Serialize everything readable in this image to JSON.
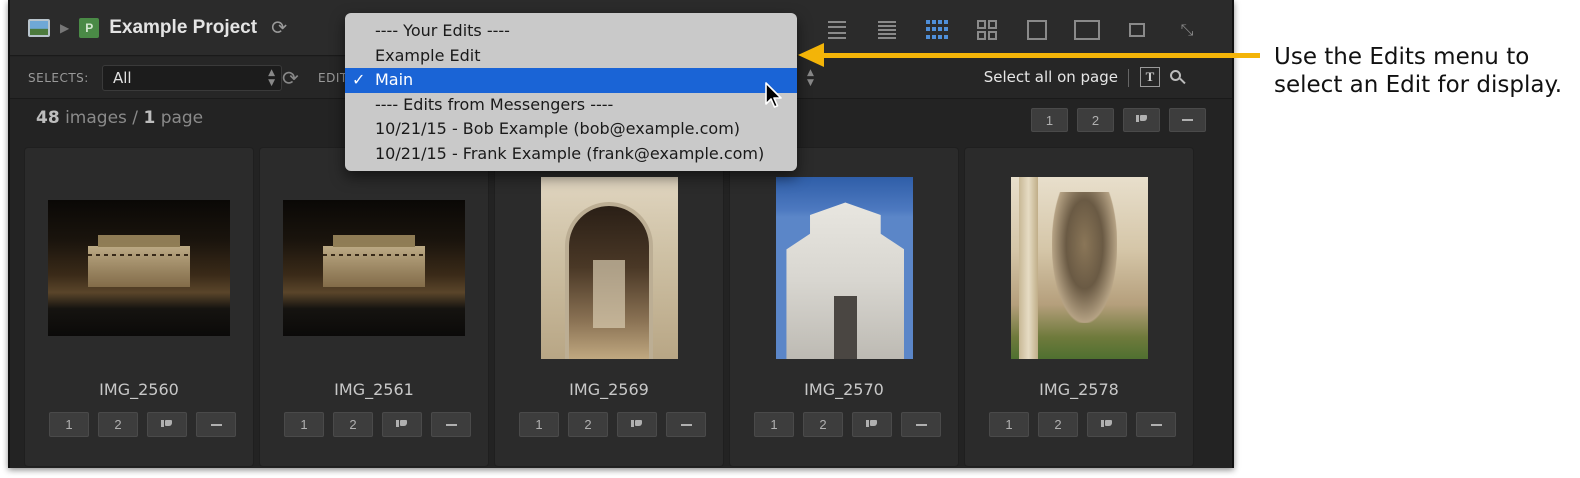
{
  "titlebar": {
    "project_title": "Example Project",
    "icons": [
      "image-icon",
      "breadcrumb-arrow-icon",
      "project-icon",
      "refresh-icon"
    ],
    "project_badge": "P",
    "view_icons": [
      "filmstrip-icon",
      "list-icon",
      "grid-small-icon",
      "grid-large-icon",
      "single-icon",
      "compare-icon",
      "overlap-icon",
      "fullscreen-icon"
    ]
  },
  "toolbar": {
    "selects_label": "SELECTS:",
    "selects_value": "All",
    "edit_label": "EDIT",
    "select_all": "Select all on page",
    "divider": "|",
    "text_icon_glyph": "T"
  },
  "stats": {
    "image_count": "48",
    "images_word": "images",
    "separator": "/",
    "page_count": "1",
    "page_word": "page"
  },
  "rating_buttons": {
    "one": "1",
    "two": "2"
  },
  "dropdown": {
    "items": [
      {
        "label": "---- Your Edits ----",
        "type": "header"
      },
      {
        "label": "Example Edit",
        "type": "option"
      },
      {
        "label": "Main",
        "type": "option",
        "selected": true,
        "check": "✓"
      },
      {
        "label": "---- Edits from Messengers ----",
        "type": "header"
      },
      {
        "label": "10/21/15 - Bob Example (bob@example.com)",
        "type": "option"
      },
      {
        "label": "10/21/15 - Frank Example (frank@example.com)",
        "type": "option"
      }
    ]
  },
  "images": [
    {
      "name": "IMG_2560",
      "orientation": "landscape"
    },
    {
      "name": "IMG_2561",
      "orientation": "landscape"
    },
    {
      "name": "IMG_2569",
      "orientation": "portrait"
    },
    {
      "name": "IMG_2570",
      "orientation": "portrait"
    },
    {
      "name": "IMG_2578",
      "orientation": "portrait"
    }
  ],
  "annotation": {
    "text": "Use the Edits menu to select an Edit for display.",
    "color": "#f3b408"
  },
  "colors": {
    "selection": "#1a64d6",
    "accent_grid": "#4f8fd9",
    "background": "#232323"
  }
}
